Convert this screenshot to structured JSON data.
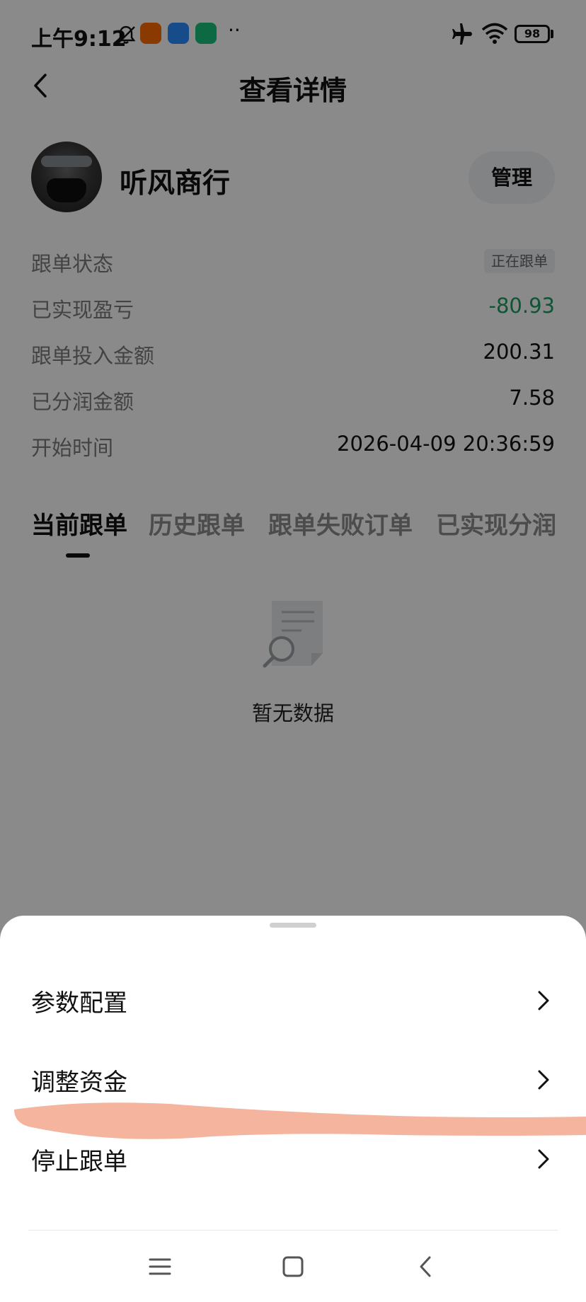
{
  "status_bar": {
    "time": "上午9:12",
    "notification_icons": [
      "bell-off-icon",
      "mi-app-icon",
      "browser-app-icon",
      "mijia-app-icon"
    ],
    "more_dots": "··",
    "airplane_mode": true,
    "wifi": true,
    "battery": "98"
  },
  "header": {
    "title": "查看详情",
    "back_icon": "chevron-left-icon"
  },
  "profile": {
    "name": "听风商行",
    "manage_label": "管理"
  },
  "info": {
    "status_label": "跟单状态",
    "status_value": "正在跟单",
    "pnl_label": "已实现盈亏",
    "pnl_value": "-80.93",
    "invest_label": "跟单投入金额",
    "invest_value": "200.31",
    "share_label": "已分润金额",
    "share_value": "7.58",
    "start_label": "开始时间",
    "start_value": "2026-04-09 20:36:59"
  },
  "tabs": [
    {
      "label": "当前跟单",
      "active": true
    },
    {
      "label": "历史跟单",
      "active": false
    },
    {
      "label": "跟单失败订单",
      "active": false
    },
    {
      "label": "已实现分润",
      "active": false
    }
  ],
  "empty_state": {
    "text": "暂无数据",
    "icon": "empty-document-search-icon"
  },
  "sheet": {
    "items": [
      {
        "label": "参数配置"
      },
      {
        "label": "调整资金"
      },
      {
        "label": "停止跟单"
      }
    ]
  },
  "nav_bar": {
    "buttons": [
      "menu-icon",
      "home-icon",
      "back-icon"
    ]
  },
  "colors": {
    "negative_green": "#1a9e5f",
    "overlay": "#000000",
    "scribble": "#f4b49e"
  }
}
